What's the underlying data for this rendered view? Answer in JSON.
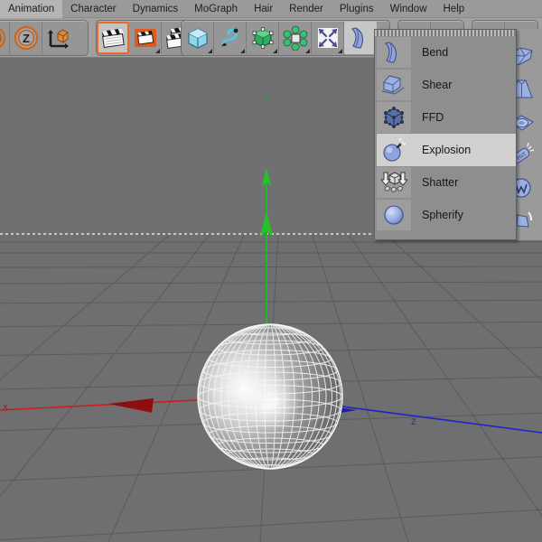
{
  "menubar": {
    "items": [
      {
        "label": "Animation"
      },
      {
        "label": "Character"
      },
      {
        "label": "Dynamics"
      },
      {
        "label": "MoGraph"
      },
      {
        "label": "Hair"
      },
      {
        "label": "Render"
      },
      {
        "label": "Plugins"
      },
      {
        "label": "Window"
      },
      {
        "label": "Help"
      }
    ]
  },
  "toolbar": {
    "groups": [
      {
        "name": "undo-redo-axis-group",
        "buttons": [
          {
            "icon": "undo-circle-icon",
            "state": "normal"
          },
          {
            "icon": "z-axis-lock-icon",
            "state": "normal"
          },
          {
            "icon": "object-axis-icon",
            "state": "normal"
          }
        ]
      },
      {
        "name": "render-group",
        "buttons": [
          {
            "icon": "render-view-icon",
            "state": "selected"
          },
          {
            "icon": "render-region-icon",
            "state": "normal"
          },
          {
            "icon": "render-queue-icon",
            "state": "normal"
          }
        ]
      },
      {
        "name": "primitives-group",
        "buttons": [
          {
            "icon": "cube-primitive-icon",
            "state": "normal"
          },
          {
            "icon": "spline-pen-icon",
            "state": "normal"
          },
          {
            "icon": "nurbs-cube-icon",
            "state": "normal"
          },
          {
            "icon": "array-object-icon",
            "state": "normal"
          },
          {
            "icon": "scatter-deform-icon",
            "state": "normal"
          },
          {
            "icon": "bend-deformer-icon",
            "state": "active"
          }
        ]
      },
      {
        "name": "lights-camera-group",
        "buttons": [
          {
            "icon": "light-icon",
            "state": "normal"
          },
          {
            "icon": "camera-icon",
            "state": "normal"
          }
        ]
      },
      {
        "name": "material-group",
        "buttons": [
          {
            "icon": "floor-object-icon",
            "state": "normal"
          }
        ]
      }
    ]
  },
  "dropdown": {
    "name": "deformer-flyout-menu",
    "items": [
      {
        "label": "Bend",
        "icon": "bend-deformer-icon",
        "highlighted": false
      },
      {
        "label": "Shear",
        "icon": "shear-deformer-icon",
        "highlighted": false
      },
      {
        "label": "FFD",
        "icon": "ffd-deformer-icon",
        "highlighted": false
      },
      {
        "label": "Explosion",
        "icon": "explosion-deformer-icon",
        "highlighted": true
      },
      {
        "label": "Shatter",
        "icon": "shatter-deformer-icon",
        "highlighted": false
      },
      {
        "label": "Spherify",
        "icon": "spherify-deformer-icon",
        "highlighted": false
      }
    ],
    "right_strip_icons": [
      "twist-deformer-icon",
      "taper-deformer-icon",
      "bulge-deformer-icon",
      "explosionfx-deformer-icon",
      "wind-deformer-icon",
      "wrap-deformer-icon"
    ]
  },
  "viewport": {
    "name": "perspective-viewport",
    "object": "sphere-wireframe",
    "axes": [
      {
        "name": "y-axis",
        "label": "Y",
        "color": "#22b822"
      },
      {
        "name": "x-axis",
        "label": "X",
        "color": "#d01b1b"
      },
      {
        "name": "z-axis",
        "label": "Z",
        "color": "#2222c8"
      }
    ],
    "background_color": "#706f71",
    "ground_color": "#6f6e70",
    "grid_line_color": "#5a595b"
  }
}
